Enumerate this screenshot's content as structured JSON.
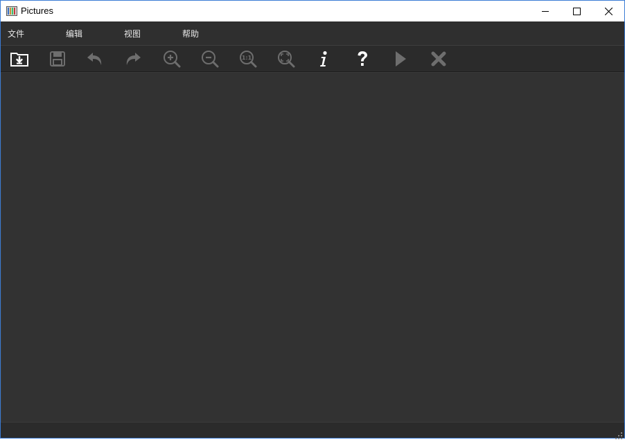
{
  "window": {
    "title": "Pictures",
    "app_icon": "picture-stack-icon",
    "controls": [
      "minimize-icon",
      "maximize-icon",
      "close-icon"
    ]
  },
  "menubar": {
    "items": [
      {
        "label": "文件"
      },
      {
        "label": "编辑"
      },
      {
        "label": "视图"
      },
      {
        "label": "帮助"
      }
    ]
  },
  "toolbar": {
    "buttons": [
      {
        "icon": "open-folder-icon",
        "enabled": true
      },
      {
        "icon": "save-icon",
        "enabled": false
      },
      {
        "icon": "undo-icon",
        "enabled": false
      },
      {
        "icon": "redo-icon",
        "enabled": false
      },
      {
        "icon": "zoom-in-icon",
        "enabled": false
      },
      {
        "icon": "zoom-out-icon",
        "enabled": false
      },
      {
        "icon": "actual-size-icon",
        "enabled": false,
        "text": "1:1"
      },
      {
        "icon": "fit-to-window-icon",
        "enabled": false
      },
      {
        "icon": "info-icon",
        "enabled": true
      },
      {
        "icon": "help-icon",
        "enabled": true
      },
      {
        "icon": "play-icon",
        "enabled": false
      },
      {
        "icon": "delete-icon",
        "enabled": false
      }
    ]
  },
  "colors": {
    "background": "#2b2b2b",
    "canvas": "#323232",
    "icon_enabled": "#ffffff",
    "icon_disabled": "#6e6e6e"
  }
}
